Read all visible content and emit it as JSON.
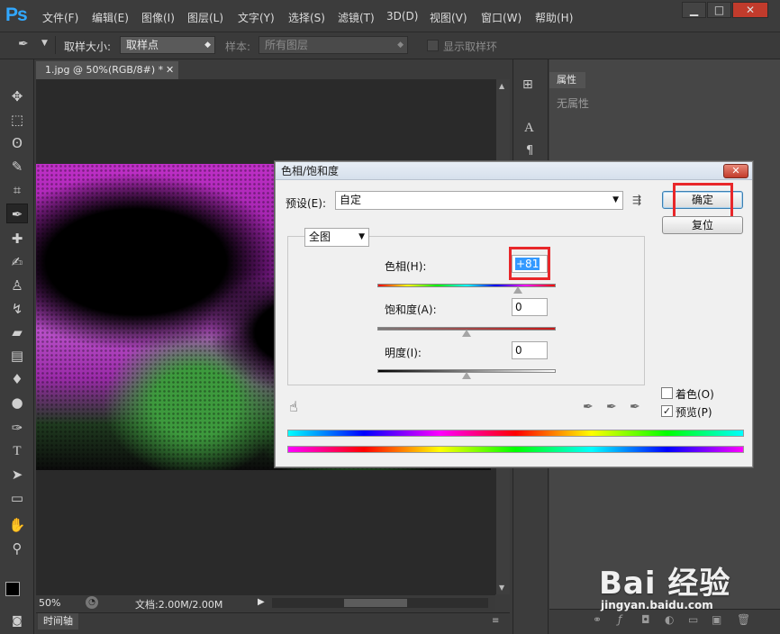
{
  "app": {
    "logo": "Ps"
  },
  "menu": [
    "文件(F)",
    "编辑(E)",
    "图像(I)",
    "图层(L)",
    "文字(Y)",
    "选择(S)",
    "滤镜(T)",
    "3D(D)",
    "视图(V)",
    "窗口(W)",
    "帮助(H)"
  ],
  "window_buttons": {
    "minimize": "▁",
    "maximize": "□",
    "close": "✕"
  },
  "options": {
    "sample_size_label": "取样大小:",
    "sample_size_value": "取样点",
    "sample_label": "样本:",
    "sample_value": "所有图层",
    "show_ring_label": "显示取样环"
  },
  "document": {
    "tab_title": "1.jpg @ 50%(RGB/8#) *",
    "zoom": "50%",
    "doc_size": "文档:2.00M/2.00M"
  },
  "timeline": {
    "tab": "时间轴"
  },
  "properties": {
    "tab": "属性",
    "empty_text": "无属性"
  },
  "dialog": {
    "title": "色相/饱和度",
    "preset_label": "预设(E):",
    "preset_value": "自定",
    "ok": "确定",
    "reset": "复位",
    "channel": "全图",
    "hue_label": "色相(H):",
    "hue_value": "+81",
    "hue_position": 0.79,
    "saturation_label": "饱和度(A):",
    "saturation_value": "0",
    "saturation_position": 0.5,
    "lightness_label": "明度(I):",
    "lightness_value": "0",
    "lightness_position": 0.5,
    "colorize_label": "着色(O)",
    "colorize_checked": false,
    "preview_label": "预览(P)",
    "preview_checked": true
  },
  "watermark": {
    "logo": "Bai 经验",
    "url": "jingyan.baidu.com"
  }
}
